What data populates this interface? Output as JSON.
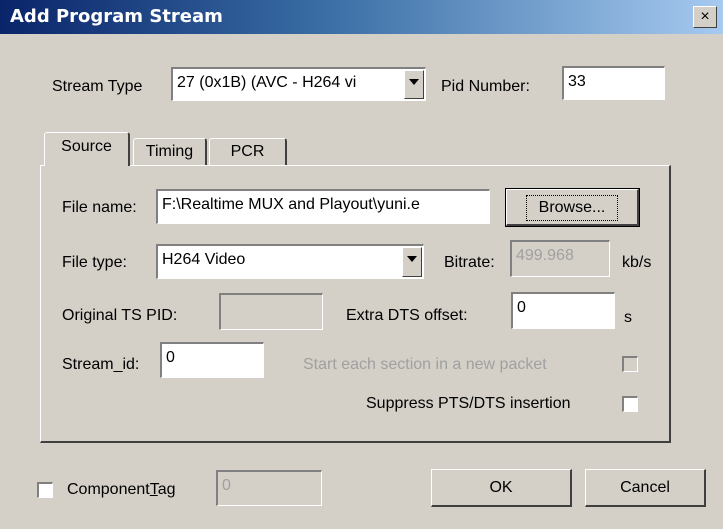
{
  "window": {
    "title": "Add Program Stream",
    "close_label": "×"
  },
  "top": {
    "stream_type_label": "Stream Type",
    "stream_type_value": "27 (0x1B) (AVC - H264 vi",
    "pid_label": "Pid Number:",
    "pid_value": "33"
  },
  "tabs": [
    {
      "label": "Source",
      "active": true
    },
    {
      "label": "Timing",
      "active": false
    },
    {
      "label": "PCR",
      "active": false
    }
  ],
  "source": {
    "file_name_label": "File name:",
    "file_name_value": "F:\\Realtime MUX and Playout\\yuni.e",
    "browse_label": "Browse...",
    "file_type_label": "File type:",
    "file_type_value": "H264 Video",
    "bitrate_label": "Bitrate:",
    "bitrate_value": "499.968",
    "bitrate_unit": "kb/s",
    "original_pid_label": "Original TS PID:",
    "original_pid_value": "",
    "extra_dts_label": "Extra DTS offset:",
    "extra_dts_value": "0",
    "extra_dts_unit": "s",
    "stream_id_label": "Stream_id:",
    "stream_id_value": "0",
    "new_packet_label": "Start each section in a new packet",
    "suppress_label": "Suppress PTS/DTS insertion"
  },
  "bottom": {
    "component_tag_label_pre": "Component",
    "component_tag_label_u": "T",
    "component_tag_label_post": "ag",
    "component_tag_value": "0",
    "ok_label": "OK",
    "cancel_label": "Cancel"
  }
}
